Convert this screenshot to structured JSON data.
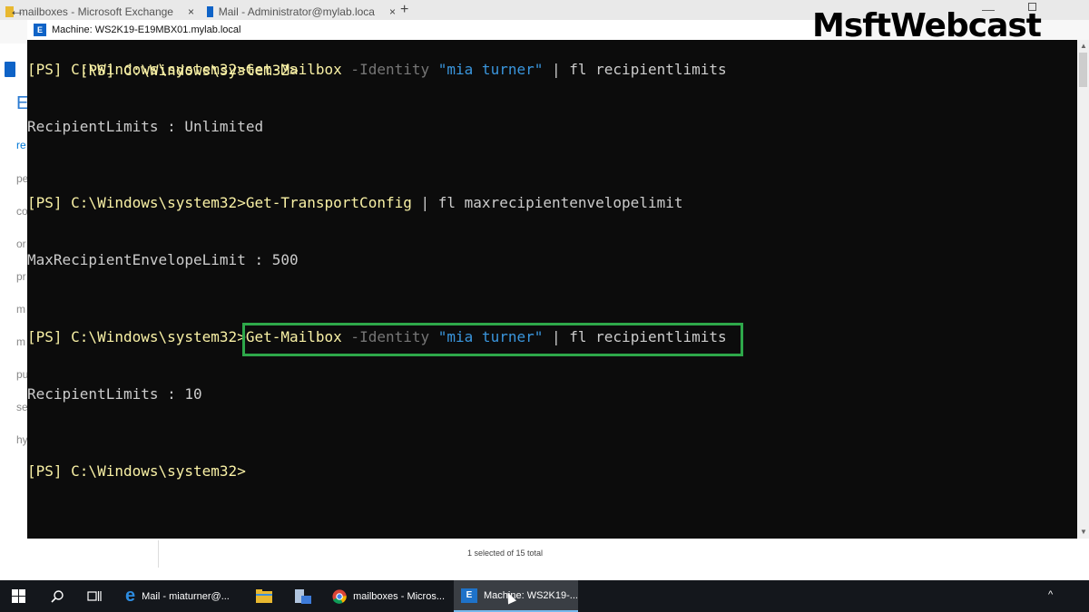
{
  "browser": {
    "tabs": [
      {
        "label": "mailboxes - Microsoft Exchange",
        "close": "×"
      },
      {
        "label": "Mail - Administrator@mylab.loca",
        "close": "×"
      }
    ],
    "new_tab": "+",
    "back": "←"
  },
  "eac_side": {
    "letters": [
      "E",
      "re",
      "pe",
      "co",
      "or",
      "pr",
      "m",
      "m",
      "pu",
      "se",
      "hy"
    ]
  },
  "console": {
    "title": "Machine: WS2K19-E19MBX01.mylab.local",
    "title_icon": "exchange-icon",
    "lines": [
      {
        "prompt": "[PS] C:\\Windows\\system32>",
        "cmd": "",
        "param": "",
        "str": "",
        "rest": ""
      },
      {
        "prompt": "[PS] C:\\Windows\\system32>",
        "cmd": "Get-Mailbox",
        "param": " -Identity ",
        "str": "\"mia turner\"",
        "rest": " | fl recipientlimits"
      },
      {
        "output": "RecipientLimits : Unlimited"
      },
      {
        "prompt": "[PS] C:\\Windows\\system32>",
        "cmd": "Get-TransportConfig",
        "param": "",
        "str": "",
        "rest": " | fl maxrecipientenvelopelimit"
      },
      {
        "output": "MaxRecipientEnvelopeLimit : 500"
      },
      {
        "prompt": "[PS] C:\\Windows\\system32>",
        "cmd": "Get-Mailbox",
        "param": " -Identity ",
        "str": "\"mia turner\"",
        "rest": " | fl recipientlimits"
      },
      {
        "output": "RecipientLimits : 10"
      },
      {
        "prompt": "[PS] C:\\Windows\\system32>",
        "cmd": "",
        "param": "",
        "str": "",
        "rest": ""
      }
    ]
  },
  "watermark": "MsftWebcast",
  "footer": {
    "selection_count": "1 selected of 15 total"
  },
  "taskbar": {
    "items": [
      {
        "label": "Mail - miaturner@...",
        "icon": "edge-icon"
      },
      {
        "label": "mailboxes - Micros...",
        "icon": "chrome-icon"
      },
      {
        "label": "Machine: WS2K19-...",
        "icon": "exchange-shell-icon"
      }
    ],
    "tray_arrow": "^"
  },
  "colors": {
    "console_bg": "#0c0c0c",
    "command": "#f9f1a5",
    "parameter": "#767676",
    "string": "#3a96dd",
    "highlight_box": "#2ea84a",
    "taskbar_bg": "#14171c"
  }
}
